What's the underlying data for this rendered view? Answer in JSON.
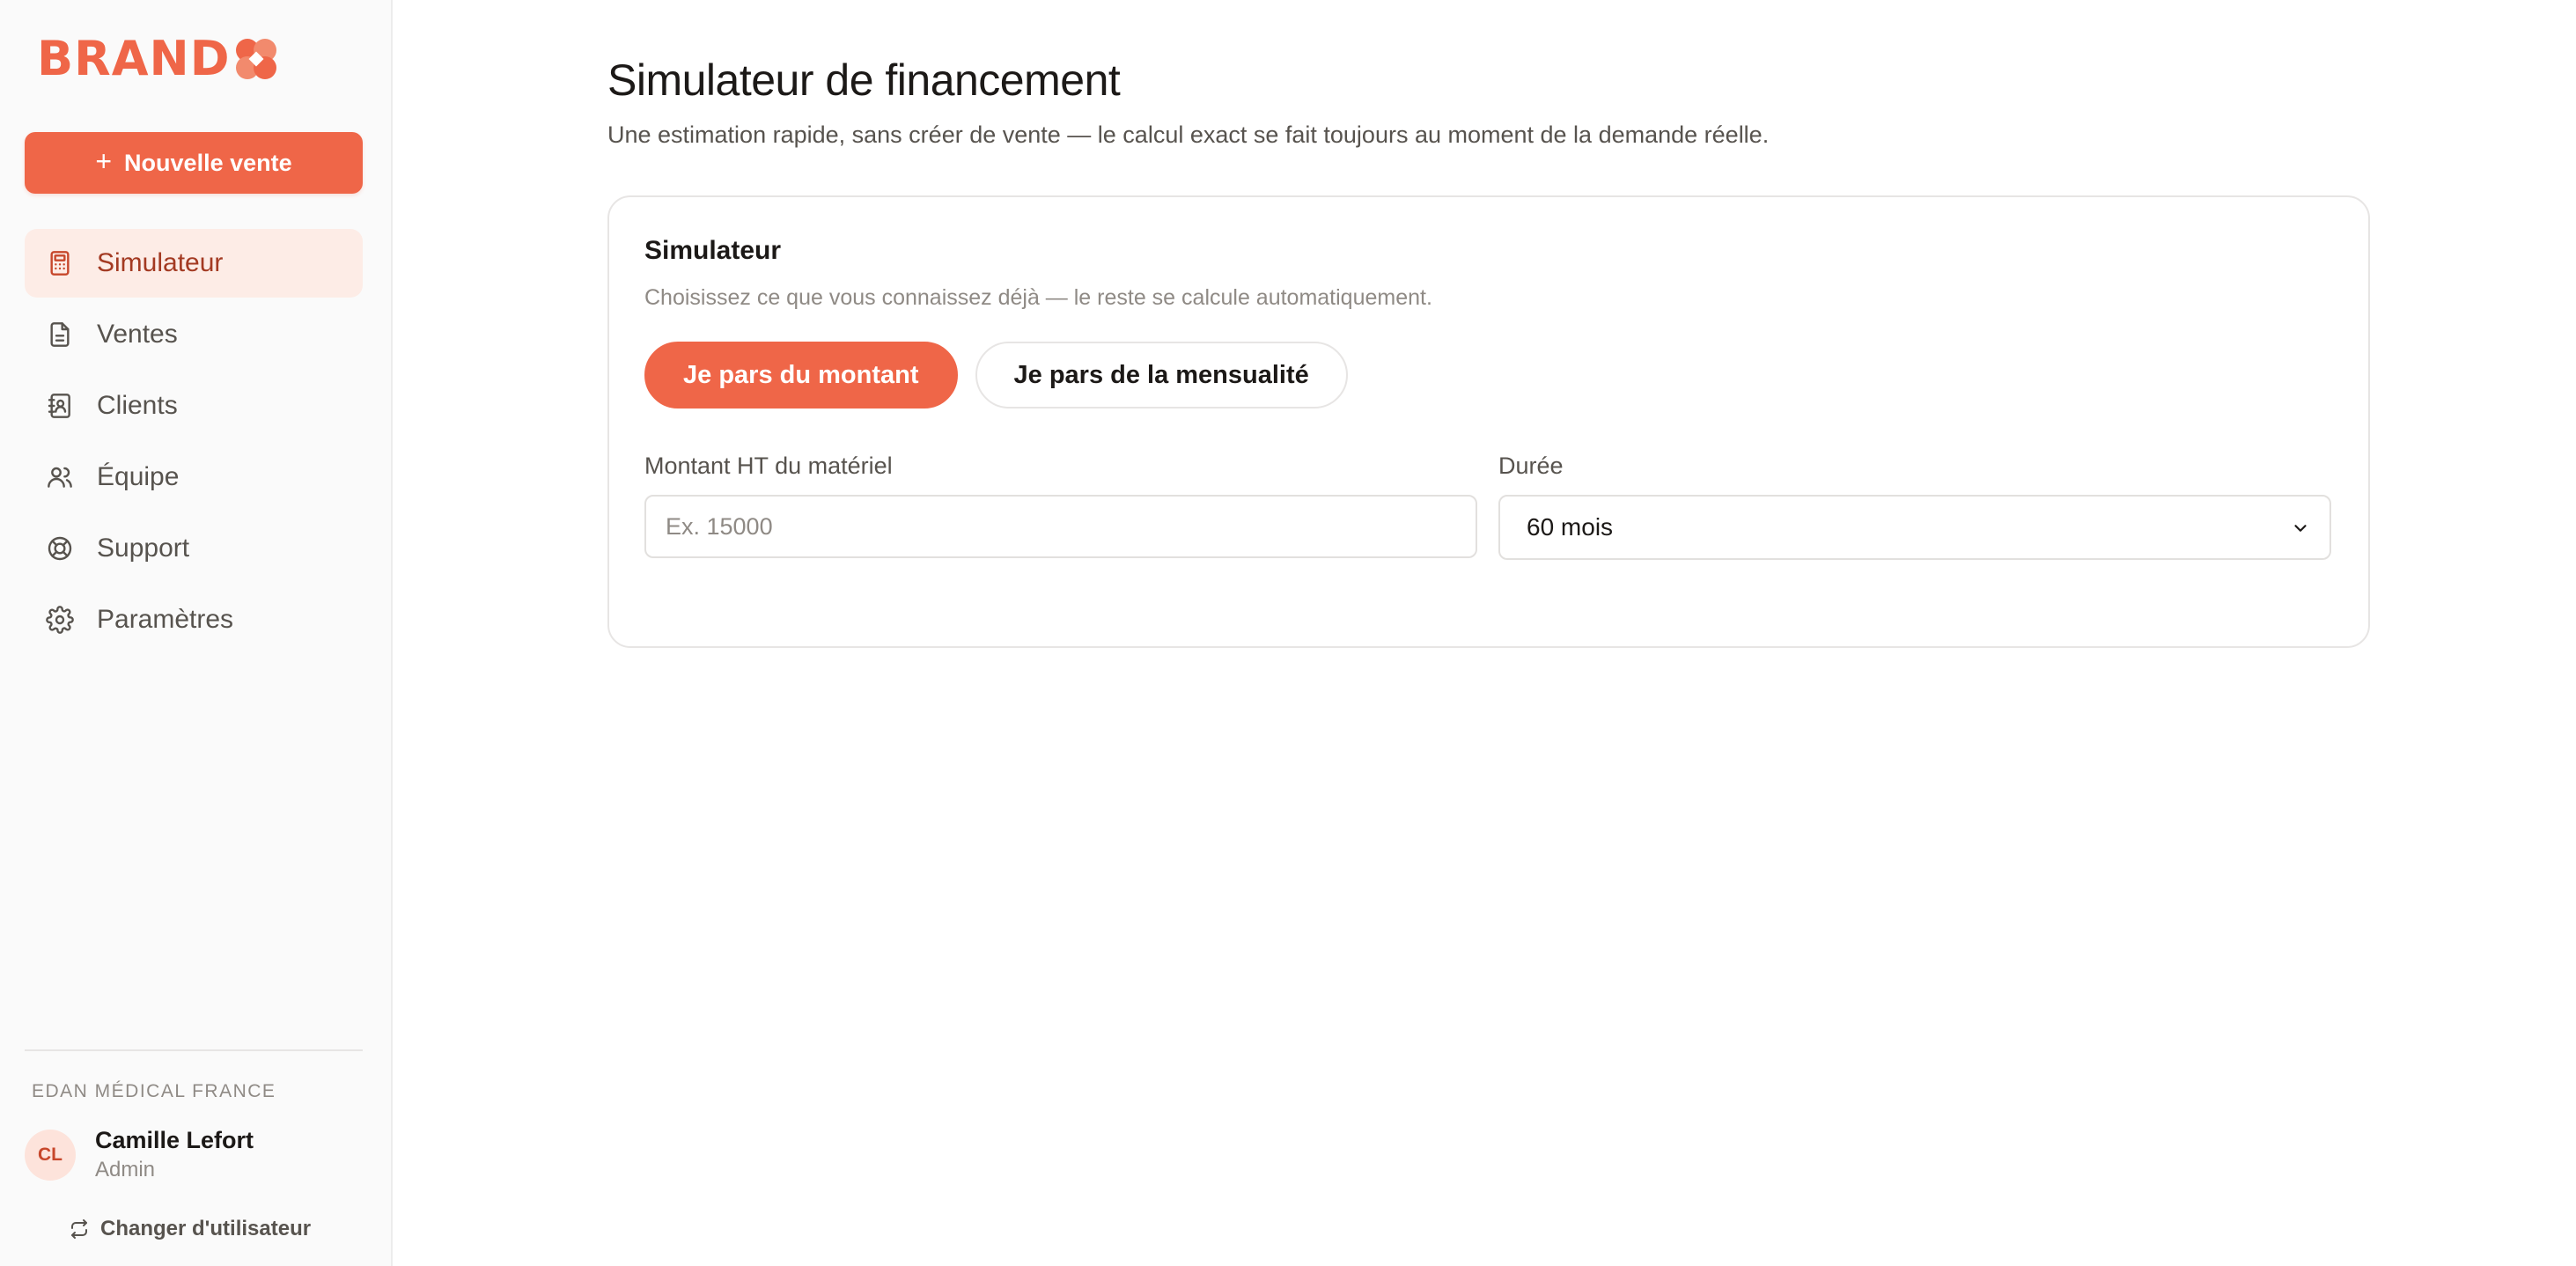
{
  "brand": {
    "name": "BRAND",
    "accent_color": "#ef6648"
  },
  "sidebar": {
    "new_sale_label": "Nouvelle vente",
    "items": [
      {
        "label": "Simulateur",
        "icon": "calculator-icon",
        "active": true
      },
      {
        "label": "Ventes",
        "icon": "document-icon",
        "active": false
      },
      {
        "label": "Clients",
        "icon": "contacts-book-icon",
        "active": false
      },
      {
        "label": "Équipe",
        "icon": "users-icon",
        "active": false
      },
      {
        "label": "Support",
        "icon": "lifebuoy-icon",
        "active": false
      },
      {
        "label": "Paramètres",
        "icon": "gear-icon",
        "active": false
      }
    ],
    "organization": "EDAN MÉDICAL FRANCE",
    "user": {
      "initials": "CL",
      "name": "Camille Lefort",
      "role": "Admin"
    },
    "switch_user_label": "Changer d'utilisateur"
  },
  "main": {
    "title": "Simulateur de financement",
    "subtitle": "Une estimation rapide, sans créer de vente — le calcul exact se fait toujours au moment de la demande réelle."
  },
  "card": {
    "title": "Simulateur",
    "description": "Choisissez ce que vous connaissez déjà — le reste se calcule automatiquement.",
    "toggle": {
      "option_amount": "Je pars du montant",
      "option_monthly": "Je pars de la mensualité",
      "selected": "option_amount"
    },
    "amount_field": {
      "label": "Montant HT du matériel",
      "value": "",
      "placeholder": "Ex. 15000"
    },
    "duration_field": {
      "label": "Durée",
      "selected": "60 mois"
    }
  }
}
